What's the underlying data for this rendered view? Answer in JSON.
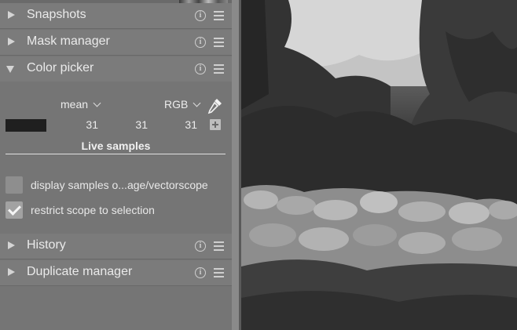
{
  "modules": {
    "snapshots": {
      "label": "Snapshots"
    },
    "mask_manager": {
      "label": "Mask manager"
    },
    "color_picker": {
      "label": "Color picker"
    },
    "history": {
      "label": "History"
    },
    "duplicate_manager": {
      "label": "Duplicate manager"
    },
    "info_glyph": "i"
  },
  "color_picker": {
    "statistic": "mean",
    "color_model": "RGB",
    "values": [
      "31",
      "31",
      "31"
    ],
    "swatch_color": "#1f1f1f",
    "live_samples_label": "Live samples",
    "display_samples_label": "display samples o...age/vectorscope",
    "display_samples_checked": false,
    "restrict_scope_label": "restrict scope to selection",
    "restrict_scope_checked": true
  }
}
